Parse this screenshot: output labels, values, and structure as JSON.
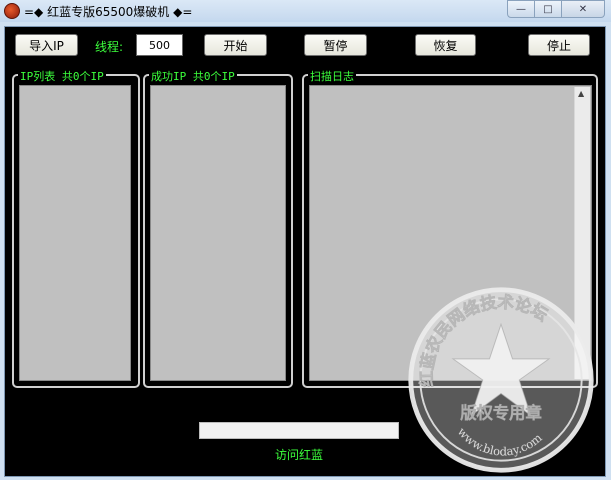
{
  "window": {
    "title": "=◆ 红蓝专版65500爆破机 ◆=",
    "background_tabs": [
      " ",
      " ",
      " ",
      " "
    ],
    "controls": {
      "minimize": "—",
      "maximize": "□",
      "close": "✕"
    }
  },
  "toolbar": {
    "import_label": "导入IP",
    "threads_label": "线程:",
    "threads_value": "500",
    "start_label": "开始",
    "pause_label": "暂停",
    "resume_label": "恢复",
    "stop_label": "停止"
  },
  "panels": {
    "ip_list_title": "IP列表 共0个IP",
    "success_ip_title": "成功IP 共0个IP",
    "scan_log_title": "扫描日志"
  },
  "progress": {
    "value": 0
  },
  "footer": {
    "visit_link": "访问红蓝"
  },
  "watermark": {
    "top_text": "红蓝农民网络技术论坛",
    "center_text": "版权专用章",
    "bottom_text": "www.bloday.com"
  },
  "colors": {
    "accent_green": "#3cff3c",
    "client_bg": "#000000",
    "list_bg": "#c0c0c0"
  }
}
